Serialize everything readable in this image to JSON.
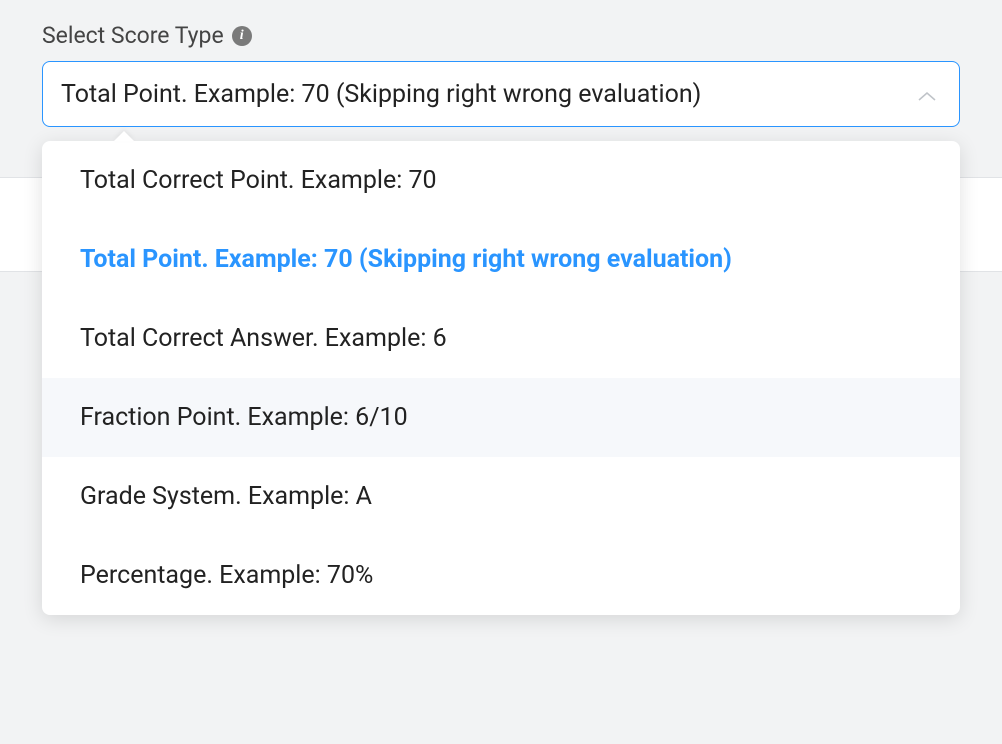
{
  "label": "Select Score Type",
  "selectedValue": "Total Point. Example: 70 (Skipping right wrong evaluation)",
  "options": [
    {
      "label": "Total Correct Point. Example: 70",
      "selected": false,
      "hover": false
    },
    {
      "label": "Total Point. Example: 70 (Skipping right wrong evaluation)",
      "selected": true,
      "hover": false
    },
    {
      "label": "Total Correct Answer. Example: 6",
      "selected": false,
      "hover": false
    },
    {
      "label": "Fraction Point. Example: 6/10",
      "selected": false,
      "hover": true
    },
    {
      "label": "Grade System. Example: A",
      "selected": false,
      "hover": false
    },
    {
      "label": "Percentage. Example: 70%",
      "selected": false,
      "hover": false
    }
  ]
}
